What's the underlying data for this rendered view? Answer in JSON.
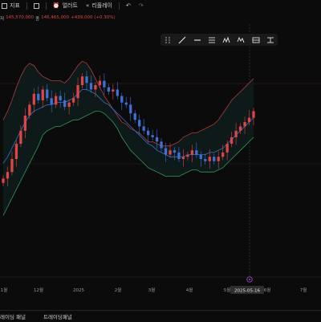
{
  "toolbar": {
    "indicators_label": "지표",
    "alerts_label": "얼러트",
    "replay_label": "리플레이"
  },
  "quote": {
    "close_prefix": "저",
    "close_value": "145,570,000",
    "high_prefix": "종",
    "high_value": "146,465,000",
    "change": "+439,000 (+0.30%)"
  },
  "bottom_tabs": [
    "레이딩 패널",
    "트레이딩패널"
  ],
  "colors": {
    "up": "#e04444",
    "down": "#3f6fd8",
    "band_upper": "#b23a3a",
    "band_lower": "#2e9a55",
    "band_mid": "#3a6fd0",
    "band_fill": "#0e1c1b"
  },
  "chart_data": {
    "type": "candlestick",
    "indicator": "bollinger_bands",
    "x_tick_labels": [
      "1월",
      "12월",
      "2025",
      "2월",
      "3월",
      "4월",
      "5월",
      "6월",
      "7월"
    ],
    "crosshair_date_label": "2025-05-16",
    "close": [
      105,
      108,
      114,
      121,
      127,
      134,
      139,
      144,
      141,
      146,
      142,
      139,
      143,
      141,
      138,
      140,
      142,
      148,
      152,
      149,
      146,
      148,
      150,
      147,
      145,
      146,
      143,
      140,
      139,
      135,
      132,
      129,
      127,
      125,
      124,
      122,
      119,
      116,
      118,
      117,
      114,
      115,
      116,
      118,
      116,
      114,
      113,
      115,
      113,
      115,
      117,
      121,
      124,
      127,
      129,
      131,
      133,
      136
    ],
    "upper_band": [
      132,
      136,
      141,
      147,
      152,
      156,
      158,
      157,
      154,
      152,
      151,
      150,
      150,
      150,
      149,
      151,
      154,
      157,
      159,
      158,
      155,
      151,
      147,
      143,
      140,
      137,
      134,
      131,
      130,
      128,
      127,
      126,
      124,
      122,
      122,
      121,
      120,
      120,
      120,
      121,
      122,
      124,
      125,
      126,
      126,
      127,
      128,
      129,
      130,
      132,
      135,
      138,
      141,
      143,
      145,
      147,
      149,
      151
    ],
    "middle_band": [
      112,
      115,
      119,
      123,
      127,
      131,
      134,
      136,
      137,
      138,
      139,
      139,
      140,
      140,
      140,
      141,
      142,
      144,
      146,
      146,
      145,
      144,
      142,
      140,
      139,
      137,
      135,
      133,
      131,
      129,
      127,
      125,
      123,
      121,
      120,
      118,
      117,
      116,
      115,
      115,
      115,
      115,
      116,
      116,
      116,
      116,
      116,
      117,
      117,
      118,
      119,
      121,
      123,
      125,
      127,
      129,
      131,
      133
    ],
    "lower_band": [
      88,
      92,
      96,
      100,
      104,
      108,
      112,
      116,
      120,
      125,
      127,
      128,
      129,
      129,
      130,
      131,
      132,
      132,
      133,
      134,
      135,
      136,
      136,
      135,
      133,
      131,
      128,
      124,
      121,
      118,
      116,
      114,
      112,
      110,
      109,
      108,
      107,
      106,
      106,
      106,
      106,
      107,
      108,
      109,
      109,
      108,
      108,
      108,
      108,
      109,
      110,
      112,
      114,
      116,
      118,
      120,
      122,
      124
    ],
    "ylim": [
      80,
      165
    ]
  }
}
